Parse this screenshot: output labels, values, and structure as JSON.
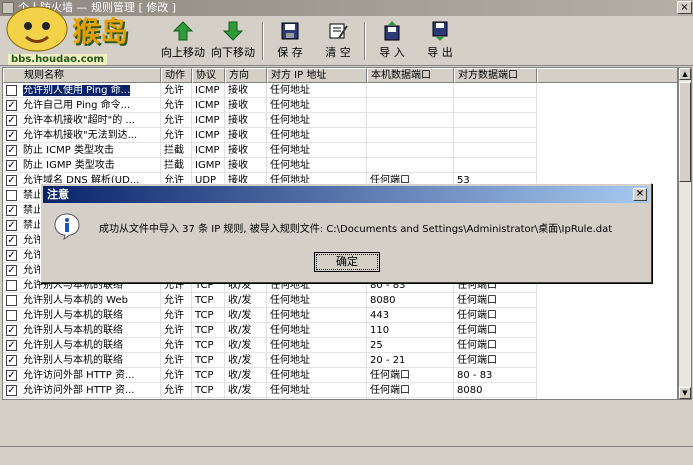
{
  "window": {
    "title": "个人防火墙 — 规则管理 [ 修改 ]"
  },
  "logo": {
    "text": "猴岛",
    "url": "bbs.houdao.com"
  },
  "toolbar": {
    "move_up": "向上移动",
    "move_down": "向下移动",
    "save": "保 存",
    "clear": "清 空",
    "import": "导 入",
    "export": "导 出"
  },
  "columns": [
    "规则名称",
    "动作",
    "协议",
    "方向",
    "对方 IP 地址",
    "本机数据端口",
    "对方数据端口"
  ],
  "rows": [
    {
      "checked": false,
      "name": "允许别人使用 Ping 命...",
      "action": "允许",
      "proto": "ICMP",
      "dir": "接收",
      "ip": "任何地址",
      "lport": "",
      "rport": "",
      "selected": true
    },
    {
      "checked": true,
      "name": "允许自己用 Ping 命令...",
      "action": "允许",
      "proto": "ICMP",
      "dir": "接收",
      "ip": "任何地址",
      "lport": "",
      "rport": ""
    },
    {
      "checked": true,
      "name": "允许本机接收\"超时\"的 ...",
      "action": "允许",
      "proto": "ICMP",
      "dir": "接收",
      "ip": "任何地址",
      "lport": "",
      "rport": ""
    },
    {
      "checked": true,
      "name": "允许本机接收\"无法到达...",
      "action": "允许",
      "proto": "ICMP",
      "dir": "接收",
      "ip": "任何地址",
      "lport": "",
      "rport": ""
    },
    {
      "checked": true,
      "name": "防止 ICMP 类型攻击",
      "action": "拦截",
      "proto": "ICMP",
      "dir": "接收",
      "ip": "任何地址",
      "lport": "",
      "rport": ""
    },
    {
      "checked": true,
      "name": "防止 IGMP 类型攻击",
      "action": "拦截",
      "proto": "IGMP",
      "dir": "接收",
      "ip": "任何地址",
      "lport": "",
      "rport": ""
    },
    {
      "checked": true,
      "name": "允许域名 DNS 解析(UD...",
      "action": "允许",
      "proto": "UDP",
      "dir": "接收",
      "ip": "任何地址",
      "lport": "任何端口",
      "rport": "53"
    },
    {
      "checked": false,
      "name": "禁止",
      "action": "",
      "proto": "",
      "dir": "",
      "ip": "",
      "lport": "",
      "rport": ""
    },
    {
      "checked": true,
      "name": "禁止",
      "action": "",
      "proto": "",
      "dir": "",
      "ip": "",
      "lport": "",
      "rport": ""
    },
    {
      "checked": true,
      "name": "禁止",
      "action": "",
      "proto": "",
      "dir": "",
      "ip": "",
      "lport": "",
      "rport": ""
    },
    {
      "checked": true,
      "name": "允许",
      "action": "",
      "proto": "",
      "dir": "",
      "ip": "",
      "lport": "",
      "rport": ""
    },
    {
      "checked": true,
      "name": "允许",
      "action": "",
      "proto": "",
      "dir": "",
      "ip": "",
      "lport": "",
      "rport": ""
    },
    {
      "checked": true,
      "name": "允许",
      "action": "",
      "proto": "",
      "dir": "",
      "ip": "",
      "lport": "",
      "rport": ""
    },
    {
      "checked": false,
      "name": "允许别人与本机的联络",
      "action": "允许",
      "proto": "TCP",
      "dir": "收/发",
      "ip": "任何地址",
      "lport": "80 - 83",
      "rport": "任何端口"
    },
    {
      "checked": false,
      "name": "允许别人与本机的 Web",
      "action": "允许",
      "proto": "TCP",
      "dir": "收/发",
      "ip": "任何地址",
      "lport": "8080",
      "rport": "任何端口"
    },
    {
      "checked": false,
      "name": "允许别人与本机的联络",
      "action": "允许",
      "proto": "TCP",
      "dir": "收/发",
      "ip": "任何地址",
      "lport": "443",
      "rport": "任何端口"
    },
    {
      "checked": true,
      "name": "允许别人与本机的联络",
      "action": "允许",
      "proto": "TCP",
      "dir": "收/发",
      "ip": "任何地址",
      "lport": "110",
      "rport": "任何端口"
    },
    {
      "checked": true,
      "name": "允许别人与本机的联络",
      "action": "允许",
      "proto": "TCP",
      "dir": "收/发",
      "ip": "任何地址",
      "lport": "25",
      "rport": "任何端口"
    },
    {
      "checked": true,
      "name": "允许别人与本机的联络",
      "action": "允许",
      "proto": "TCP",
      "dir": "收/发",
      "ip": "任何地址",
      "lport": "20 - 21",
      "rport": "任何端口"
    },
    {
      "checked": true,
      "name": "允许访问外部 HTTP 资...",
      "action": "允许",
      "proto": "TCP",
      "dir": "收/发",
      "ip": "任何地址",
      "lport": "任何端口",
      "rport": "80 - 83"
    },
    {
      "checked": true,
      "name": "允许访问外部 HTTP 资...",
      "action": "允许",
      "proto": "TCP",
      "dir": "收/发",
      "ip": "任何地址",
      "lport": "任何端口",
      "rport": "8080"
    },
    {
      "checked": false,
      "name": "",
      "action": "",
      "proto": "",
      "dir": "",
      "ip": "",
      "lport": "",
      "rport": ""
    }
  ],
  "dialog": {
    "title": "注意",
    "message": "成功从文件中导入 37 条 IP 规则, 被导入规则文件: C:\\Documents and Settings\\Administrator\\桌面\\IpRule.dat",
    "ok": "确定"
  },
  "colors": {
    "dialog_title": "#0a246a",
    "selection": "#0a246a",
    "face": "#d4d0c8"
  }
}
